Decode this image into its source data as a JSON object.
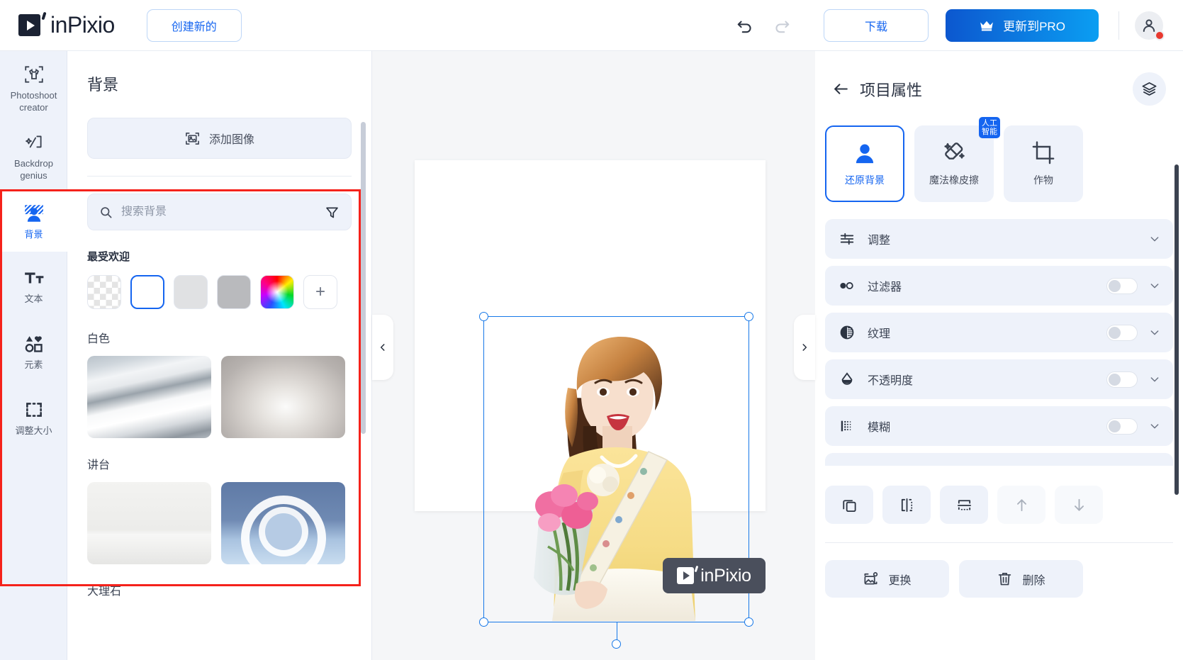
{
  "topbar": {
    "brand": "inPixio",
    "create_new": "创建新的",
    "undo_icon": "undo-icon",
    "redo_icon": "redo-icon",
    "download": "下载",
    "upgrade_pro": "更新到PRO",
    "avatar_icon": "user-avatar-icon"
  },
  "rail": {
    "items": [
      {
        "label": "Photoshoot\ncreator",
        "line1": "Photoshoot",
        "line2": "creator",
        "icon": "tshirt-frame-icon",
        "active": false
      },
      {
        "label": "Backdrop genius",
        "line1": "Backdrop",
        "line2": "genius",
        "icon": "backdrop-genius-icon",
        "active": false
      },
      {
        "label": "背景",
        "line1": "背景",
        "line2": "",
        "icon": "background-person-icon",
        "active": true
      },
      {
        "label": "文本",
        "line1": "文本",
        "line2": "",
        "icon": "text-tt-icon",
        "active": false
      },
      {
        "label": "元素",
        "line1": "元素",
        "line2": "",
        "icon": "shapes-elements-icon",
        "active": false
      },
      {
        "label": "调整大小",
        "line1": "调整大小",
        "line2": "",
        "icon": "resize-dashed-icon",
        "active": false
      }
    ]
  },
  "panel": {
    "title": "背景",
    "add_image": "添加图像",
    "search_placeholder": "搜索背景",
    "search_value": "",
    "filter_icon": "filter-funnel-icon",
    "search_icon": "search-icon",
    "popular_title": "最受欢迎",
    "swatches": [
      {
        "name": "transparent",
        "kind": "checker"
      },
      {
        "name": "white",
        "kind": "sel"
      },
      {
        "name": "light-gray",
        "kind": "gray1"
      },
      {
        "name": "gray",
        "kind": "gray2"
      },
      {
        "name": "color-picker",
        "kind": "rainbow"
      },
      {
        "name": "add-color",
        "kind": "plus",
        "label": "+"
      }
    ],
    "sections": [
      {
        "title": "白色",
        "thumbs": [
          {
            "name": "white-dunes",
            "kind": "t-dunes"
          },
          {
            "name": "white-arches",
            "kind": "t-arch"
          }
        ]
      },
      {
        "title": "讲台",
        "thumbs": [
          {
            "name": "white-podium-plants",
            "kind": "t-podium"
          },
          {
            "name": "blue-ring-podium",
            "kind": "t-blue"
          }
        ]
      },
      {
        "title": "大理石",
        "thumbs": []
      }
    ]
  },
  "canvas": {
    "watermark": "inPixio",
    "collapse_left_icon": "chevron-left-icon",
    "collapse_right_icon": "chevron-right-icon"
  },
  "rightpanel": {
    "back_icon": "arrow-left-icon",
    "title": "项目属性",
    "layers_icon": "layers-icon",
    "tools": [
      {
        "label": "还原背景",
        "icon": "person-restore-icon",
        "active": true,
        "badge": null
      },
      {
        "label": "魔法橡皮擦",
        "icon": "magic-eraser-icon",
        "active": false,
        "badge": "人工智能",
        "badge_l1": "人工",
        "badge_l2": "智能"
      },
      {
        "label": "作物",
        "icon": "crop-icon",
        "active": false,
        "badge": null
      }
    ],
    "rows": [
      {
        "label": "调整",
        "icon": "sliders-icon",
        "toggle": false,
        "chevron": true
      },
      {
        "label": "过滤器",
        "icon": "filters-circles-icon",
        "toggle": true,
        "toggle_on": false,
        "chevron": true
      },
      {
        "label": "纹理",
        "icon": "contrast-texture-icon",
        "toggle": true,
        "toggle_on": false,
        "chevron": true
      },
      {
        "label": "不透明度",
        "icon": "opacity-drop-icon",
        "toggle": true,
        "toggle_on": false,
        "chevron": true
      },
      {
        "label": "模糊",
        "icon": "blur-grid-icon",
        "toggle": true,
        "toggle_on": false,
        "chevron": true
      }
    ],
    "align_buttons": [
      {
        "name": "duplicate-button",
        "icon": "duplicate-icon",
        "dim": false
      },
      {
        "name": "flip-horizontal-button",
        "icon": "flip-horizontal-icon",
        "dim": false
      },
      {
        "name": "flip-vertical-button",
        "icon": "flip-vertical-icon",
        "dim": false
      },
      {
        "name": "move-up-button",
        "icon": "arrow-up-icon",
        "dim": true
      },
      {
        "name": "move-down-button",
        "icon": "arrow-down-icon",
        "dim": true
      }
    ],
    "replace_label": "更换",
    "replace_icon": "replace-image-icon",
    "delete_label": "删除",
    "delete_icon": "trash-icon"
  },
  "colors": {
    "accent": "#1565f0",
    "pro_gradient_start": "#0c57cf",
    "pro_gradient_end": "#0b9ef2",
    "panel_fill": "#eef2fa",
    "highlight_box": "#f5221b",
    "selection": "#1778e8"
  }
}
